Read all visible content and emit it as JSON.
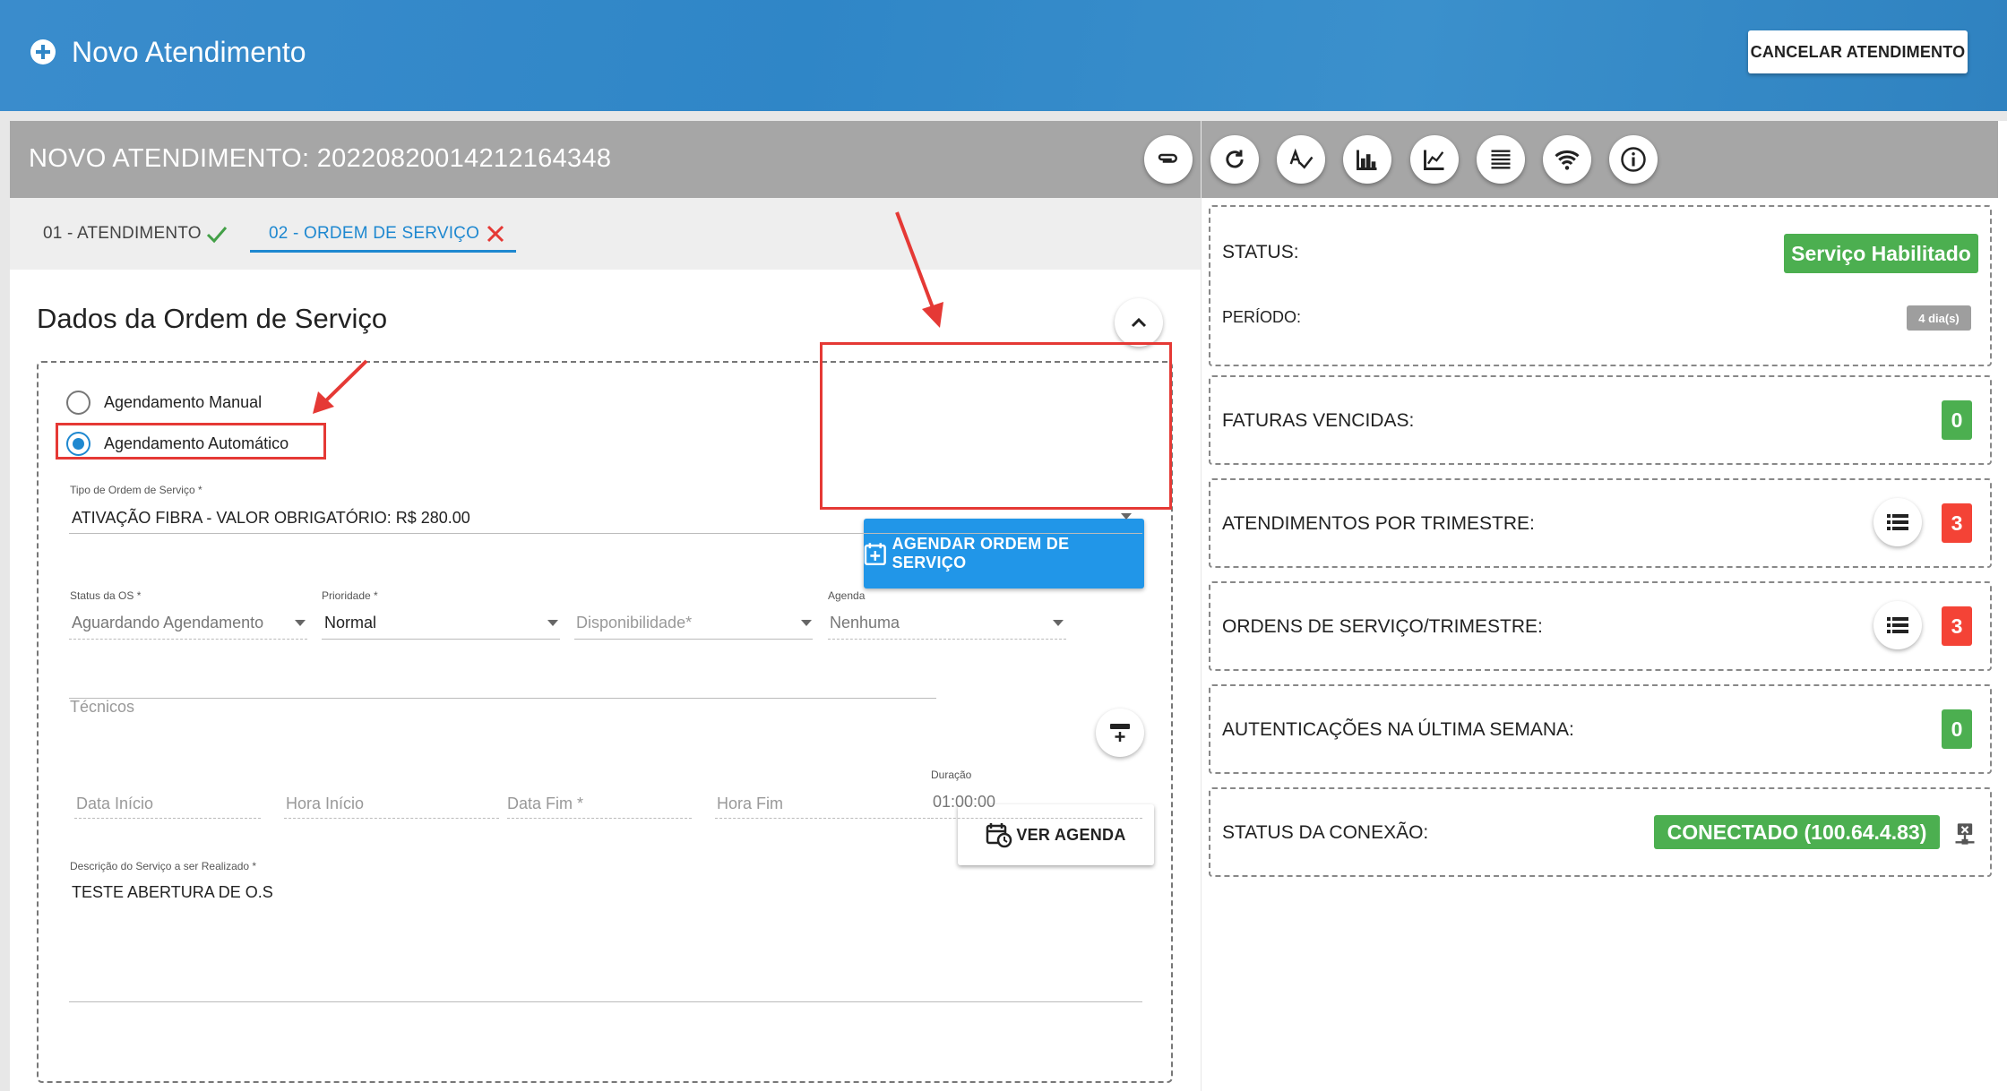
{
  "app": {
    "title": "Novo Atendimento",
    "cancel_label": "CANCELAR ATENDIMENTO"
  },
  "panel": {
    "header_title": "NOVO ATENDIMENTO: 20220820014212164348",
    "tabs": [
      {
        "label": "01 - ATENDIMENTO",
        "status": "done"
      },
      {
        "label": "02 - ORDEM DE SERVIÇO",
        "status": "error"
      }
    ],
    "toolbar_icons": [
      "paperclip-icon",
      "refresh-icon",
      "spellcheck-icon",
      "bar-chart-icon",
      "line-chart-icon",
      "list-icon",
      "wifi-icon",
      "info-icon"
    ]
  },
  "form": {
    "section_title": "Dados da Ordem de Serviço",
    "radio_manual": "Agendamento Manual",
    "radio_auto": "Agendamento Automático",
    "selected_radio": "Agendamento Automático",
    "schedule_button": "AGENDAR ORDEM DE SERVIÇO",
    "tipo_label": "Tipo de Ordem de Serviço *",
    "tipo_value": "ATIVAÇÃO FIBRA - VALOR OBRIGATÓRIO: R$ 280.00",
    "status_label": "Status da OS *",
    "status_value": "Aguardando Agendamento",
    "prioridade_label": "Prioridade *",
    "prioridade_value": "Normal",
    "disponibilidade_placeholder": "Disponibilidade*",
    "agenda_label": "Agenda",
    "agenda_value": "Nenhuma",
    "tecnicos_placeholder": "Técnicos",
    "ver_agenda_button": "VER AGENDA",
    "data_inicio_placeholder": "Data Início",
    "hora_inicio_placeholder": "Hora Início",
    "data_fim_placeholder": "Data Fim *",
    "hora_fim_placeholder": "Hora Fim",
    "duracao_label": "Duração",
    "duracao_value": "01:00:00",
    "descricao_label": "Descrição do Serviço a ser Realizado *",
    "descricao_value": "TESTE ABERTURA DE O.S"
  },
  "stats": {
    "status_label": "STATUS:",
    "status_value": "Serviço Habilitado",
    "periodo_label": "PERÍODO:",
    "periodo_value": "4 dia(s)",
    "faturas_label": "FATURAS VENCIDAS:",
    "faturas_value": "0",
    "atendimentos_label": "ATENDIMENTOS POR TRIMESTRE:",
    "atendimentos_value": "3",
    "ordens_label": "ORDENS DE SERVIÇO/TRIMESTRE:",
    "ordens_value": "3",
    "autenticacoes_label": "AUTENTICAÇÕES NA ÚLTIMA SEMANA:",
    "autenticacoes_value": "0",
    "conexao_label": "STATUS DA CONEXÃO:",
    "conexao_value": "CONECTADO (100.64.4.83)"
  },
  "colors": {
    "brand_blue": "#2f86c7",
    "accent_blue": "#2196e8",
    "green": "#4caf50",
    "red": "#f44336",
    "annotation_red": "#e53935"
  }
}
